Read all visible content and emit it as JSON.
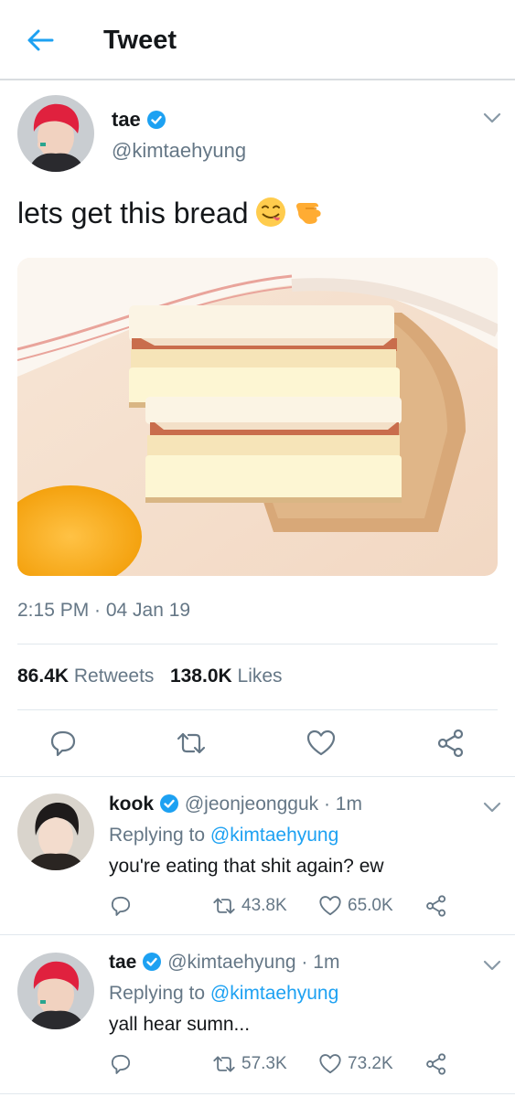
{
  "header": {
    "title": "Tweet"
  },
  "tweet": {
    "name": "tae",
    "handle": "@kimtaehyung",
    "text": "lets get this bread",
    "timestamp": "2:15 PM · 04 Jan 19",
    "retweets_count": "86.4K",
    "retweets_label": "Retweets",
    "likes_count": "138.0K",
    "likes_label": "Likes"
  },
  "replies": [
    {
      "name": "kook",
      "handle": "@jeonjeongguk",
      "time": "1m",
      "replying_prefix": "Replying to",
      "replying_to": "@kimtaehyung",
      "text": "you're eating that shit again? ew",
      "retweets": "43.8K",
      "likes": "65.0K"
    },
    {
      "name": "tae",
      "handle": "@kimtaehyung",
      "time": "1m",
      "replying_prefix": "Replying to",
      "replying_to": "@kimtaehyung",
      "text": "yall hear sumn...",
      "retweets": "57.3K",
      "likes": "73.2K"
    }
  ],
  "colors": {
    "accent": "#1da1f2",
    "secondary_text": "#657786",
    "divider": "#e1e8ed"
  },
  "icons": [
    "back-arrow-icon",
    "verified-icon",
    "chevron-down-icon",
    "reply-icon",
    "retweet-icon",
    "like-icon",
    "share-icon"
  ]
}
